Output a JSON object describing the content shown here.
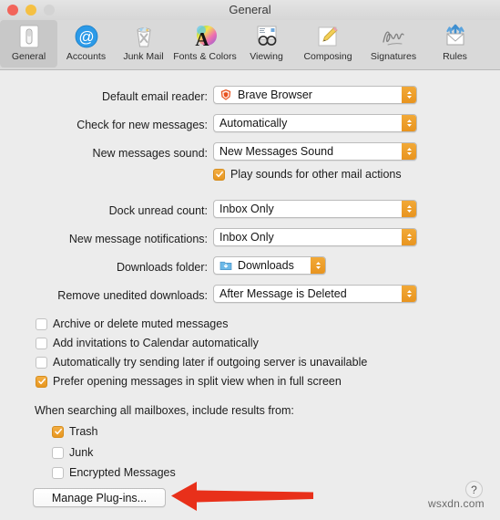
{
  "window": {
    "title": "General",
    "traffic_lights": [
      "close-button",
      "minimize-button",
      "zoom-button"
    ]
  },
  "toolbar": {
    "items": [
      {
        "label": "General",
        "icon": "general-switch-icon",
        "selected": true
      },
      {
        "label": "Accounts",
        "icon": "accounts-at-sign-icon",
        "selected": false
      },
      {
        "label": "Junk Mail",
        "icon": "junk-mail-trash-icon",
        "selected": false
      },
      {
        "label": "Fonts & Colors",
        "icon": "fonts-colors-wheel-icon",
        "selected": false
      },
      {
        "label": "Viewing",
        "icon": "viewing-glasses-icon",
        "selected": false
      },
      {
        "label": "Composing",
        "icon": "composing-pencil-icon",
        "selected": false
      },
      {
        "label": "Signatures",
        "icon": "signatures-script-icon",
        "selected": false
      },
      {
        "label": "Rules",
        "icon": "rules-envelope-icon",
        "selected": false
      }
    ]
  },
  "form": {
    "rows": [
      {
        "label": "Default email reader:",
        "value": "Brave Browser",
        "icon": "brave-lion-icon"
      },
      {
        "label": "Check for new messages:",
        "value": "Automatically",
        "icon": null
      },
      {
        "label": "New messages sound:",
        "value": "New Messages Sound",
        "icon": null
      },
      {
        "label": "Dock unread count:",
        "value": "Inbox Only",
        "icon": null
      },
      {
        "label": "New message notifications:",
        "value": "Inbox Only",
        "icon": null
      },
      {
        "label": "Downloads folder:",
        "value": "Downloads",
        "icon": "downloads-folder-icon"
      },
      {
        "label": "Remove unedited downloads:",
        "value": "After Message is Deleted",
        "icon": null
      }
    ],
    "play_sounds": {
      "label": "Play sounds for other mail actions",
      "checked": true
    }
  },
  "options": {
    "checkboxes": [
      {
        "label": "Archive or delete muted messages",
        "checked": false
      },
      {
        "label": "Add invitations to Calendar automatically",
        "checked": false
      },
      {
        "label": "Automatically try sending later if outgoing server is unavailable",
        "checked": false
      },
      {
        "label": "Prefer opening messages in split view when in full screen",
        "checked": true
      }
    ]
  },
  "search_section": {
    "heading": "When searching all mailboxes, include results from:",
    "checkboxes": [
      {
        "label": "Trash",
        "checked": true
      },
      {
        "label": "Junk",
        "checked": false
      },
      {
        "label": "Encrypted Messages",
        "checked": false
      }
    ]
  },
  "footer": {
    "manage_plugins_label": "Manage Plug-ins...",
    "help_label": "?",
    "watermark": "wsxdn.com"
  },
  "annotation": {
    "arrow_color": "#e8301a",
    "points_at": "manage-plugins-button"
  },
  "colors": {
    "accent": "#e8961f",
    "window_bg": "#ececec",
    "toolbar_bg": "#d9d9d9",
    "arrow_red": "#e8301a"
  }
}
